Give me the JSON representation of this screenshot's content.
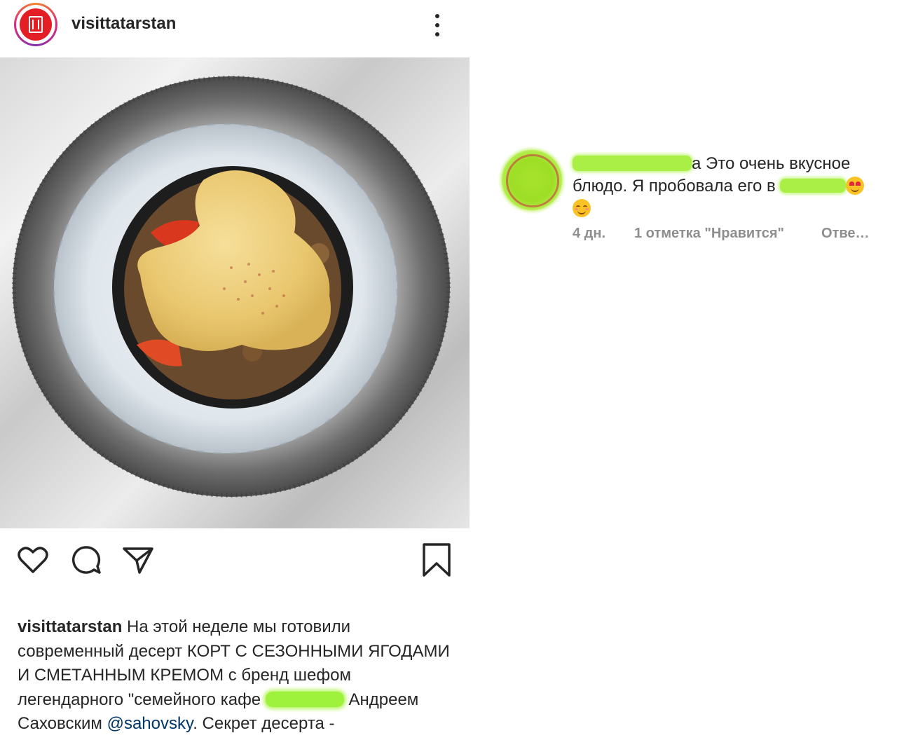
{
  "post": {
    "username": "visittatarstan",
    "more_icon": "more-vertical-icon",
    "photo_alt": "dessert on crushed ice",
    "actions": {
      "like_icon": "heart-icon",
      "comment_icon": "comment-bubble-icon",
      "share_icon": "paper-plane-icon",
      "save_icon": "bookmark-icon"
    },
    "caption": {
      "username": "visittatarstan",
      "text_1": " На этой неделе мы готовили современный десерт КОРТ С СЕЗОННЫМИ ЯГОДАМИ И СМЕТАННЫМ КРЕМОМ с бренд шефом легендарного \"семейного кафе ",
      "text_2": " Андреем Саховским ",
      "mention": "@sahovsky",
      "text_3": ". Секрет десерта -"
    }
  },
  "comment": {
    "username_suffix": "а",
    "text_1": " Это очень вкусное блюдо. Я пробовала его в ",
    "time": "4 дн.",
    "likes": "1 отметка \"Нравится\"",
    "reply": "Отве…"
  },
  "colors": {
    "text": "#262626",
    "muted": "#8e8e8e",
    "mention": "#003569",
    "brand_red": "#e31e24",
    "redaction_green": "#a9ef45"
  }
}
